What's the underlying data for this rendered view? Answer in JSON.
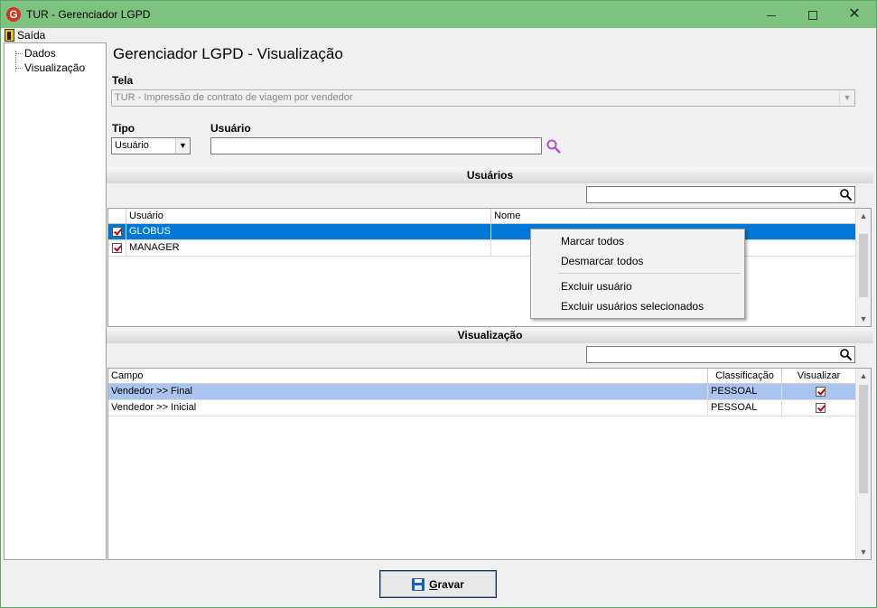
{
  "window": {
    "title": "TUR - Gerenciador LGPD",
    "icon_letter": "G",
    "controls": [
      "minimize-icon",
      "maximize-icon",
      "close-icon"
    ],
    "close_glyph": "✕"
  },
  "menu": {
    "exit_label": "Saída"
  },
  "tree": {
    "items": [
      {
        "label": "Dados"
      },
      {
        "label": "Visualização"
      }
    ]
  },
  "page": {
    "title": "Gerenciador LGPD - Visualização",
    "tela_label": "Tela",
    "tela_value": "TUR - Impressão de contrato de viagem por vendedor",
    "tipo_label": "Tipo",
    "tipo_value": "Usuário",
    "usuario_label": "Usuário",
    "usuario_value": ""
  },
  "usuarios": {
    "section_title": "Usuários",
    "filter_value": "",
    "columns": [
      "Usuário",
      "Nome"
    ],
    "rows": [
      {
        "checked": true,
        "usuario": "GLOBUS",
        "nome": "",
        "selected": true
      },
      {
        "checked": true,
        "usuario": "MANAGER",
        "nome": "",
        "selected": false
      }
    ]
  },
  "context_menu": {
    "items": [
      "Marcar todos",
      "Desmarcar todos",
      "Excluir usuário",
      "Excluir usuários selecionados"
    ]
  },
  "visualizacao": {
    "section_title": "Visualização",
    "filter_value": "",
    "columns": [
      "Campo",
      "Classificação",
      "Visualizar"
    ],
    "rows": [
      {
        "campo": "Vendedor >> Final",
        "classificacao": "PESSOAL",
        "visualizar": true,
        "selected": true
      },
      {
        "campo": "Vendedor >> Inicial",
        "classificacao": "PESSOAL",
        "visualizar": true,
        "selected": false
      }
    ]
  },
  "footer": {
    "save_label": "Gravar",
    "save_mnemonic": "G",
    "save_rest": "ravar"
  },
  "colors": {
    "titlebar": "#7dc27f",
    "row_selected_usuarios": "#0078d7",
    "row_selected_visualizacao": "#a8c4ef",
    "check_mark": "#cc0000",
    "search_magenta": "#b44fd0"
  }
}
